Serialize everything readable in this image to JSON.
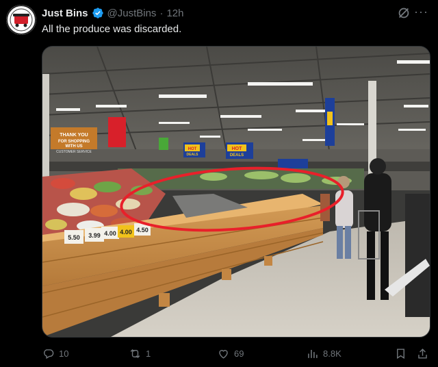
{
  "post": {
    "author_name": "Just Bins",
    "handle": "@JustBins",
    "separator": "·",
    "time": "12h",
    "text": "All the produce was discarded.",
    "more_label": "···"
  },
  "image": {
    "signs": {
      "thank_you": "THANK YOU FOR SHOPPING WITH US",
      "customer_service": "CUSTOMER SERVICE",
      "hot_deals": "HOT DEALS"
    },
    "price_tags": [
      "5.50",
      "3.99",
      "4.00",
      "4.00",
      "4.50"
    ]
  },
  "metrics": {
    "replies": "10",
    "reposts": "1",
    "likes": "69",
    "views": "8.8K"
  },
  "colors": {
    "background": "#000000",
    "text_primary": "#e7e9ea",
    "text_secondary": "#71767b",
    "verified_blue": "#1d9bf0",
    "annotation_red": "#e8202a"
  }
}
